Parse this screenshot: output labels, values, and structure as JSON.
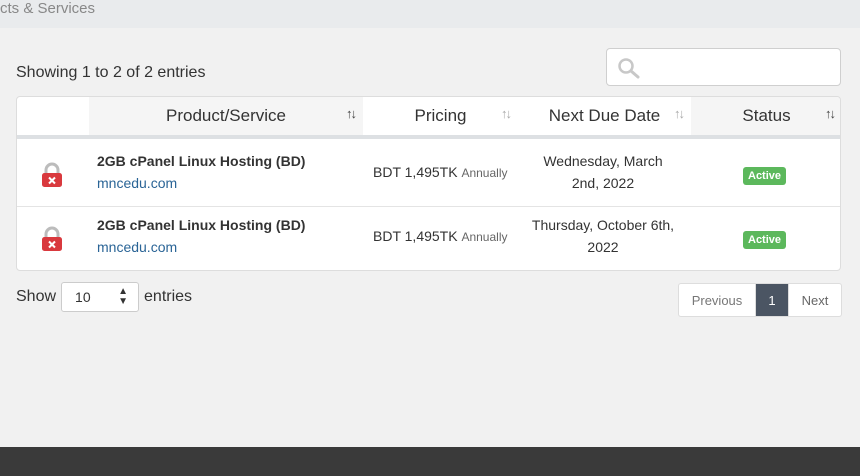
{
  "breadcrumb": "cts & Services",
  "showing_text": "Showing 1 to 2 of 2 entries",
  "search": {
    "placeholder": ""
  },
  "table": {
    "columns": [
      {
        "label": "Product/Service",
        "sort": "↑↓"
      },
      {
        "label": "Pricing",
        "sort": "↑↓"
      },
      {
        "label": "Next Due Date",
        "sort": "↑↓"
      },
      {
        "label": "Status",
        "sort": "↑↓"
      }
    ],
    "rows": [
      {
        "product": "2GB cPanel Linux Hosting (BD)",
        "domain": "mncedu.com",
        "price": "BDT 1,495TK",
        "cycle": "Annually",
        "due_line1": "Wednesday, March",
        "due_line2": "2nd, 2022",
        "status": "Active"
      },
      {
        "product": "2GB cPanel Linux Hosting (BD)",
        "domain": "mncedu.com",
        "price": "BDT 1,495TK",
        "cycle": "Annually",
        "due_line1": "Thursday, October 6th,",
        "due_line2": "2022",
        "status": "Active"
      }
    ]
  },
  "length_menu": {
    "show": "Show",
    "value": "10",
    "entries": "entries"
  },
  "pagination": {
    "previous": "Previous",
    "current": "1",
    "next": "Next"
  },
  "colors": {
    "badge": "#5cb85c",
    "lock": "#d9393e",
    "link": "#2a6496",
    "footer": "#3a3a3a"
  }
}
